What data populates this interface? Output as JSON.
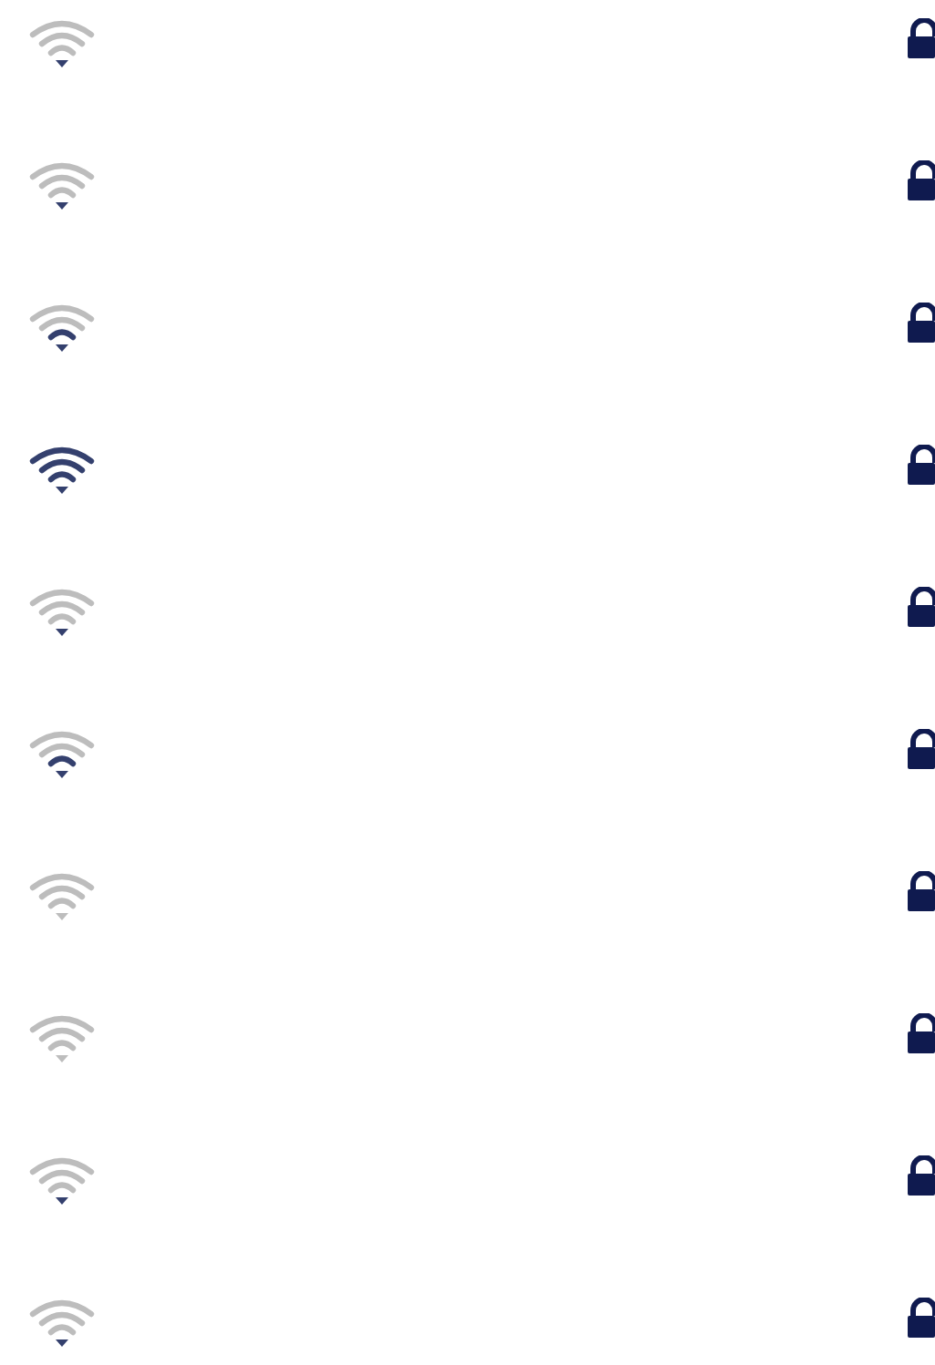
{
  "networks": [
    {
      "kind": "weak",
      "secured": true
    },
    {
      "kind": "weak",
      "secured": true
    },
    {
      "kind": "fair",
      "secured": true
    },
    {
      "kind": "full",
      "secured": true
    },
    {
      "kind": "weak",
      "secured": true
    },
    {
      "kind": "fair",
      "secured": true
    },
    {
      "kind": "none",
      "secured": true
    },
    {
      "kind": "none",
      "secured": true
    },
    {
      "kind": "weak",
      "secured": true
    },
    {
      "kind": "weak",
      "secured": true
    }
  ]
}
